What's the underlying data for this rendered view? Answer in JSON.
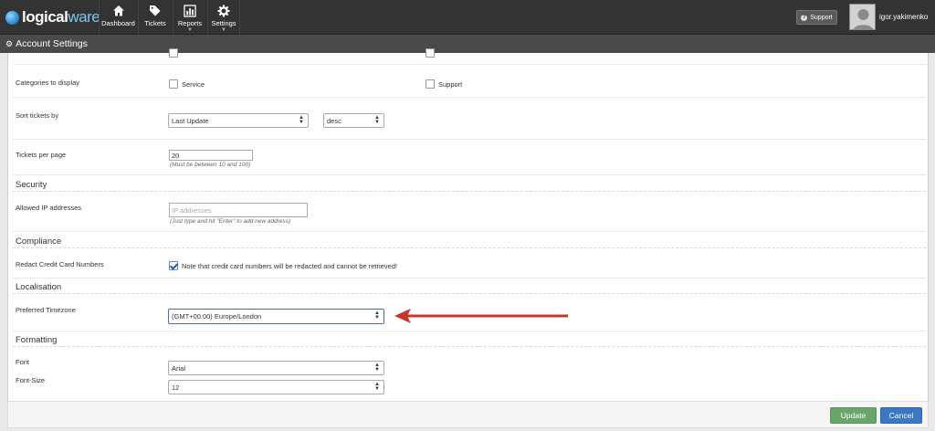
{
  "brand": {
    "name_bold": "logical",
    "name_light": "ware"
  },
  "nav": {
    "items": [
      {
        "label": "Dashboard",
        "icon": "home-icon"
      },
      {
        "label": "Tickets",
        "icon": "tags-icon"
      },
      {
        "label": "Reports",
        "icon": "bar-chart-icon"
      },
      {
        "label": "Settings",
        "icon": "gear-icon"
      }
    ],
    "support_label": "Support",
    "username": "igor.yakimenko"
  },
  "page": {
    "title": "Account Settings"
  },
  "form": {
    "categories": {
      "label": "Categories to display",
      "options": [
        "Service",
        "Support"
      ]
    },
    "sort": {
      "label": "Sort tickets by",
      "field": "Last Update",
      "order": "desc"
    },
    "tickets_per_page": {
      "label": "Tickets per page",
      "value": "20",
      "help": "(Must be between 10 and 100)"
    },
    "security": {
      "title": "Security",
      "allowed_ip_label": "Allowed IP addresses",
      "allowed_ip_placeholder": "IP addresses",
      "allowed_ip_help": "(Just type and hit \"Enter\" to add new address)"
    },
    "compliance": {
      "title": "Compliance",
      "redact_label": "Redact Credit Card Numbers",
      "redact_note": "Note that credit card numbers will be redacted and cannot be retrieved!",
      "redact_checked": true
    },
    "localisation": {
      "title": "Localisation",
      "timezone_label": "Preferred Timezone",
      "timezone_value": "(GMT+00:00) Europe/London"
    },
    "formatting": {
      "title": "Formatting",
      "font_label": "Font",
      "font_value": "Arial",
      "font_size_label": "Font-Size",
      "font_size_value": "12"
    }
  },
  "footer": {
    "update_label": "Update",
    "cancel_label": "Cancel"
  },
  "colors": {
    "update": "#6aa56a",
    "cancel": "#3a77c4",
    "arrow": "#c0392b",
    "topbar": "#333333"
  }
}
